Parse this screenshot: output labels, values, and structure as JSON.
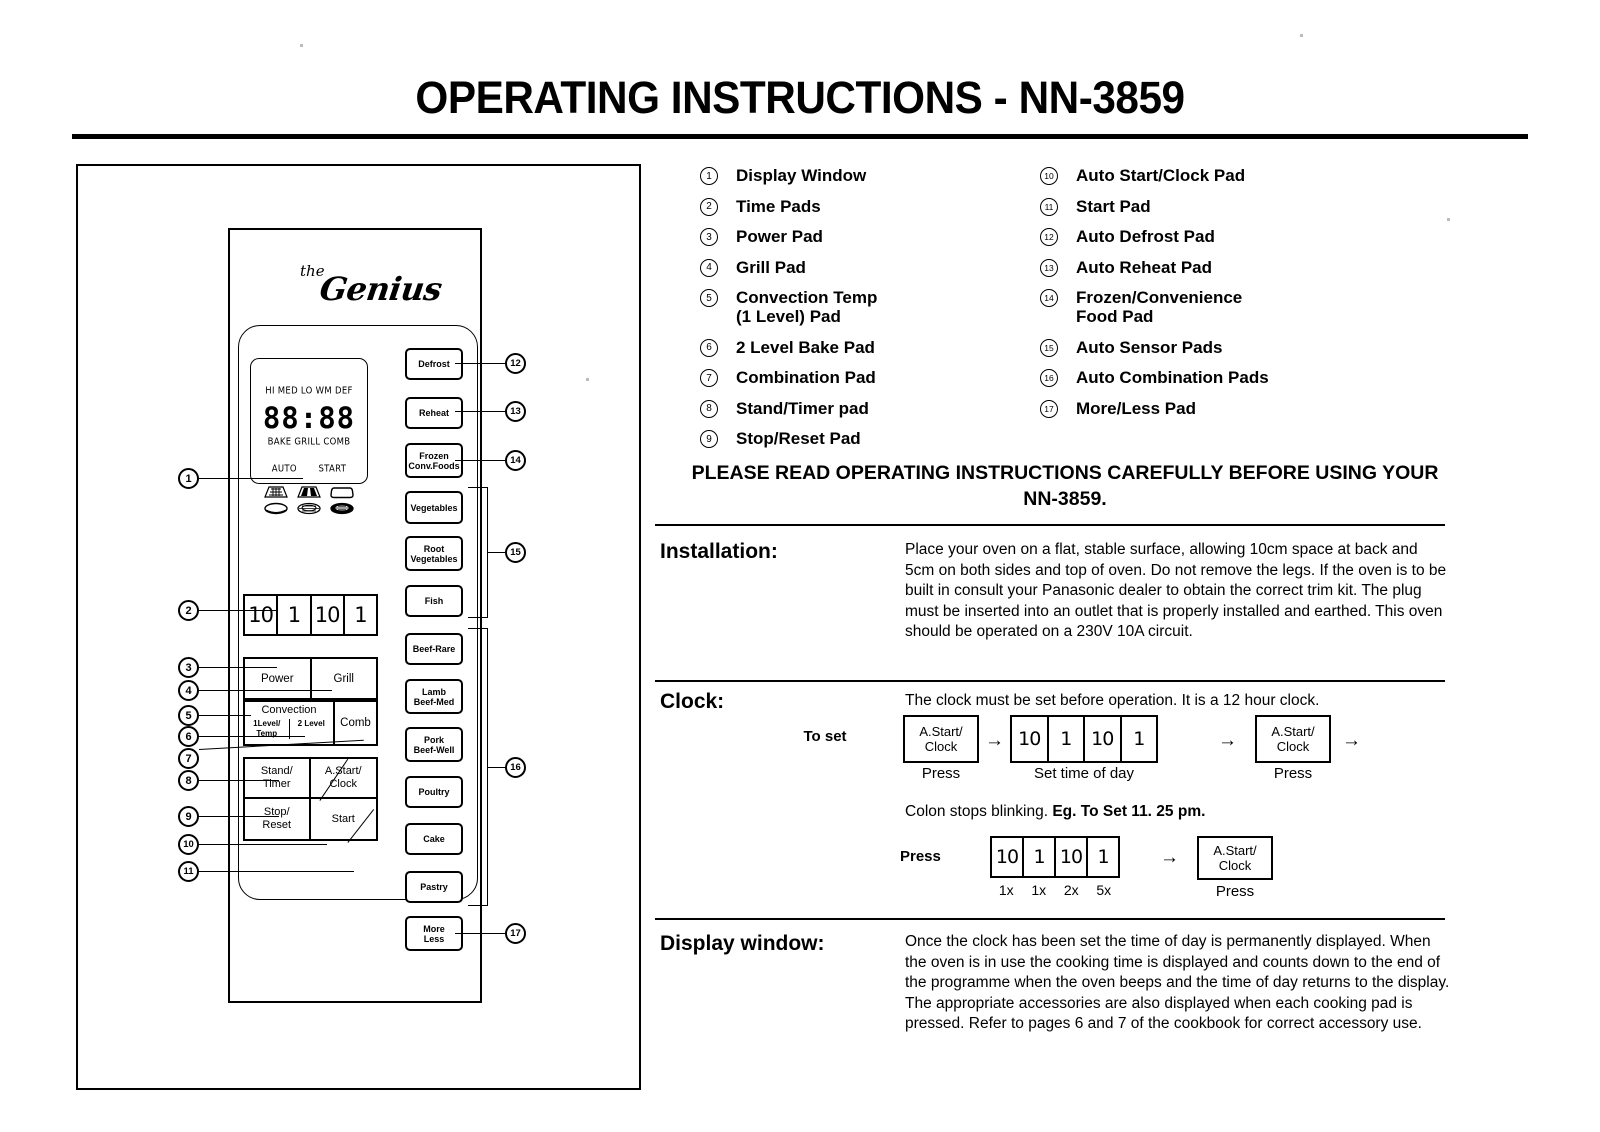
{
  "title": "OPERATING INSTRUCTIONS - NN-3859",
  "legend": {
    "left": [
      {
        "num": "1",
        "label": "Display Window"
      },
      {
        "num": "2",
        "label": "Time Pads"
      },
      {
        "num": "3",
        "label": "Power Pad"
      },
      {
        "num": "4",
        "label": "Grill Pad"
      },
      {
        "num": "5",
        "label": "Convection Temp\n(1 Level) Pad"
      },
      {
        "num": "6",
        "label": "2 Level Bake Pad"
      },
      {
        "num": "7",
        "label": "Combination Pad"
      },
      {
        "num": "8",
        "label": "Stand/Timer pad"
      },
      {
        "num": "9",
        "label": "Stop/Reset Pad"
      }
    ],
    "right": [
      {
        "num": "10",
        "label": "Auto Start/Clock Pad"
      },
      {
        "num": "11",
        "label": "Start Pad"
      },
      {
        "num": "12",
        "label": "Auto Defrost Pad"
      },
      {
        "num": "13",
        "label": "Auto Reheat Pad"
      },
      {
        "num": "14",
        "label": "Frozen/Convenience\nFood Pad"
      },
      {
        "num": "15",
        "label": "Auto Sensor Pads"
      },
      {
        "num": "16",
        "label": "Auto Combination Pads"
      },
      {
        "num": "17",
        "label": "More/Less Pad"
      }
    ]
  },
  "please_read": "PLEASE READ OPERATING INSTRUCTIONS CAREFULLY BEFORE USING YOUR NN-3859.",
  "sections": {
    "installation": {
      "heading": "Installation:",
      "body": "Place your oven on a flat, stable surface, allowing 10cm space at back and 5cm on both sides and top of oven. Do not remove the legs. If the oven is to be built in consult your Panasonic dealer to obtain the correct trim kit. The plug must be inserted into an outlet that is properly installed and earthed. This oven should be operated on a 230V 10A circuit."
    },
    "clock": {
      "heading": "Clock:",
      "intro": "The clock must be set before operation. It is a 12 hour clock.",
      "to_set_label": "To set",
      "step1_box": "A.Start/\nClock",
      "step1_caption": "Press",
      "step2_digits": [
        "10",
        "1",
        "10",
        "1"
      ],
      "step2_caption": "Set time of day",
      "step3_box": "A.Start/\nClock",
      "step3_caption": "Press",
      "arrow": "→",
      "example_line_1": "Colon stops blinking.",
      "example_bold": "Eg.",
      "example_line_2": "To Set 11. 25 pm.",
      "press_label": "Press",
      "example_digits": [
        "10",
        "1",
        "10",
        "1"
      ],
      "example_counts": [
        "1x",
        "1x",
        "2x",
        "5x"
      ],
      "example_box": "A.Start/\nClock",
      "example_caption": "Press"
    },
    "display_window": {
      "heading": "Display window:",
      "body": "Once the clock has been set the time of day is permanently displayed. When the oven is in use the cooking time is displayed and counts down to the end of the programme when the oven beeps and the time of day returns to the display.\nThe appropriate accessories are also displayed when each cooking pad is pressed. Refer to pages 6 and 7 of the cookbook for correct accessory use."
    }
  },
  "panel": {
    "brand_the": "the",
    "brand_name": "Genius",
    "display": {
      "power_levels": "HI  MED  LO    WM    DEF",
      "digits": "88:88",
      "modes": "BAKE        GRILL  COMB",
      "auto": "AUTO",
      "start": "START",
      "accessory_icons": [
        "grill-rack-icon",
        "baking-tray-icon",
        "shallow-dish-icon",
        "plate-icon",
        "round-rack-icon",
        "filled-dish-icon"
      ]
    },
    "time_pads": [
      "10",
      "1",
      "10",
      "1"
    ],
    "power_pad": "Power",
    "grill_pad": "Grill",
    "convection_title": "Convection",
    "convection_1level": "1Level/\nTemp",
    "convection_2level": "2 Level",
    "comb_pad": "Comb",
    "stand_timer": "Stand/\nTimer",
    "a_start_clock": "A.Start/\nClock",
    "stop_reset": "Stop/\nReset",
    "start": "Start",
    "auto_pads": [
      "Defrost",
      "Reheat",
      "Frozen\nConv.Foods",
      "Vegetables",
      "Root\nVegetables",
      "Fish",
      "Beef-Rare",
      "Lamb\nBeef-Med",
      "Pork\nBeef-Well",
      "Poultry",
      "Cake",
      "Pastry",
      "More\nLess"
    ],
    "callouts": [
      "1",
      "2",
      "3",
      "4",
      "5",
      "6",
      "7",
      "8",
      "9",
      "10",
      "11",
      "12",
      "13",
      "14",
      "15",
      "16",
      "17"
    ]
  }
}
